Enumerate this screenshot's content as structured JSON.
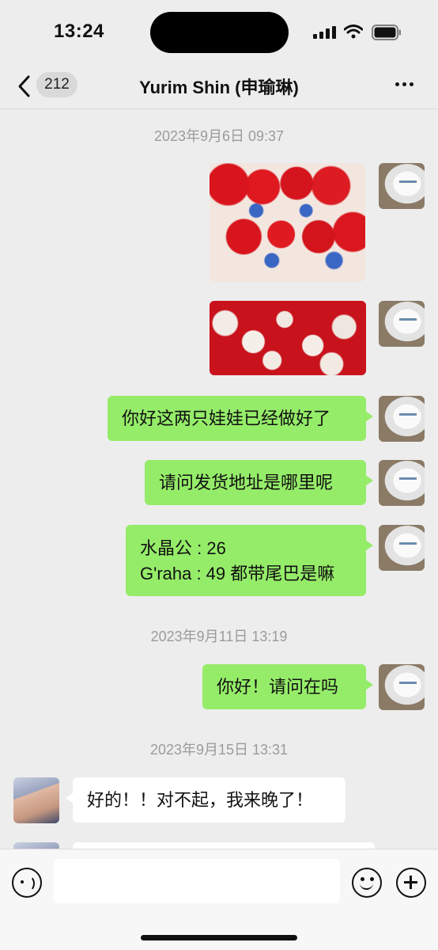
{
  "status_bar": {
    "time": "13:24"
  },
  "header": {
    "back_icon": "chevron-left-icon",
    "unread_count": "212",
    "title": "Yurim Shin (申瑜琳)",
    "more_icon": "ellipsis-icon"
  },
  "messages": {
    "ts1": "2023年9月6日 09:37",
    "msg3": "你好这两只娃娃已经做好了",
    "msg4": "请问发货地址是哪里呢",
    "msg5_line1": "水晶公 : 26",
    "msg5_line2": "G'raha : 49 都带尾巴是嘛",
    "ts2": "2023年9月11日 13:19",
    "msg6": "你好！请问在吗",
    "ts3": "2023年9月15日 13:31",
    "msg7": "好的！！对不起，我来晚了！"
  },
  "input_bar": {
    "voice_icon": "voice-icon",
    "emoji_icon": "emoji-icon",
    "plus_icon": "plus-icon",
    "value": ""
  },
  "colors": {
    "background": "#ededed",
    "outgoing_bubble": "#95ec69",
    "incoming_bubble": "#ffffff",
    "timestamp": "#9b9b9b"
  }
}
